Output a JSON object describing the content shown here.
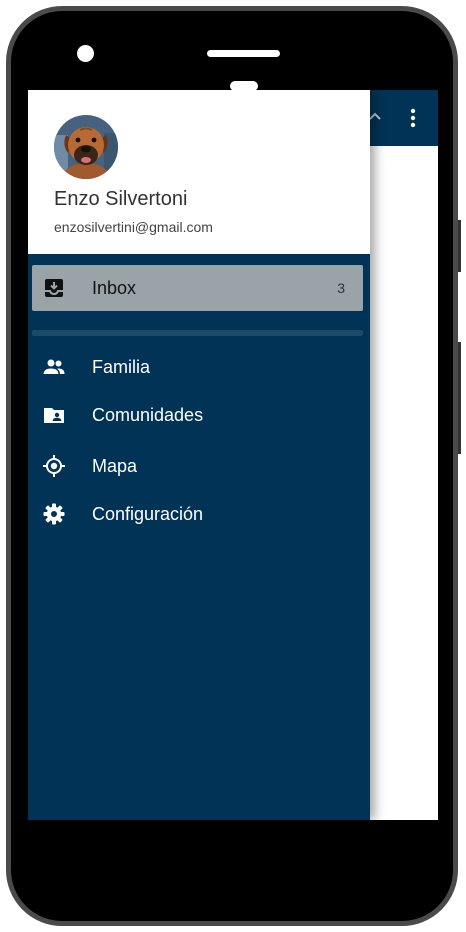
{
  "user": {
    "name": "Enzo Silvertoni",
    "email": "enzosilvertini@gmail.com",
    "avatar": "dog-avatar"
  },
  "nav": {
    "primary": {
      "label": "Inbox",
      "badge": "3",
      "icon": "inbox-icon",
      "active": true
    },
    "items": [
      {
        "label": "Familia",
        "icon": "people-icon"
      },
      {
        "label": "Comunidades",
        "icon": "folder-shared-icon"
      },
      {
        "label": "Mapa",
        "icon": "location-target-icon"
      },
      {
        "label": "Configuración",
        "icon": "gear-icon"
      }
    ]
  },
  "toolbar": {
    "more_icon": "more-vert-icon"
  },
  "colors": {
    "drawer_bg": "#003356",
    "active_item_bg": "#9aa3a8",
    "divider": "#1c4a6b",
    "header_bg": "#ffffff"
  }
}
